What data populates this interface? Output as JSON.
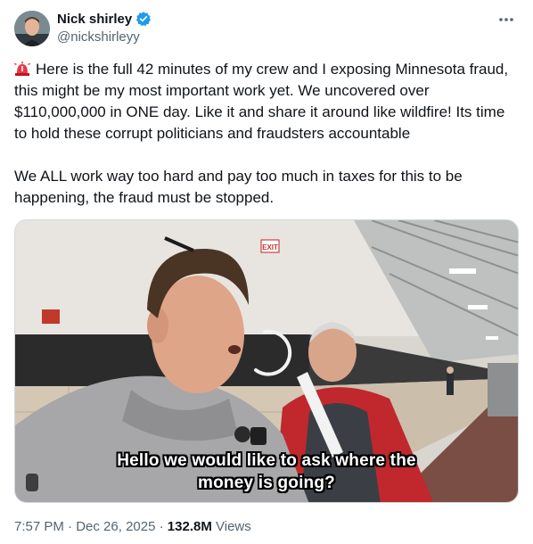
{
  "author": {
    "name": "Nick shirley",
    "handle": "@nickshirleyy",
    "verified": true
  },
  "icons": [
    "avatar",
    "verified-badge-icon",
    "more-options-icon",
    "siren-emoji-icon"
  ],
  "tweet": {
    "paragraph_1": "Here is the full 42 minutes of my crew and I exposing Minnesota fraud, this might be my most important work yet. We uncovered over $110,000,000 in ONE day. Like it and share it around like wildfire! Its time to hold these corrupt politicians and fraudsters accountable",
    "paragraph_2": "We ALL work way too hard and pay too much in taxes for this to be happening, the fraud must be stopped."
  },
  "media": {
    "subtitle_line_1": "Hello we would like to ask where the",
    "subtitle_line_2": "money is going?",
    "exit_sign": "EXIT"
  },
  "footer": {
    "time": "7:57 PM",
    "separator": "·",
    "date": "Dec 26, 2025",
    "views_count": "132.8M",
    "views_label": "Views"
  },
  "colors": {
    "verified_blue": "#1d9bf0",
    "text_primary": "#0f1419",
    "text_secondary": "#536471"
  }
}
